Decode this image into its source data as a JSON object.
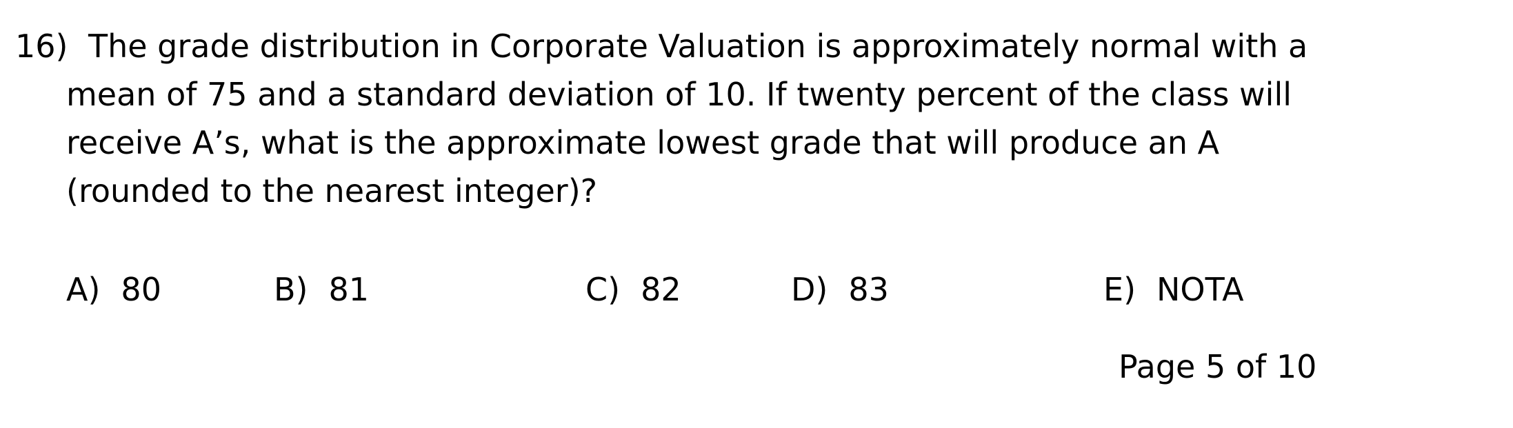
{
  "question": {
    "number": "16)",
    "lines": [
      "The grade distribution in Corporate Valuation is approximately normal with a",
      "mean of 75 and a standard deviation of 10.  If twenty percent of the class will",
      "receive A’s, what is the approximate lowest grade that will produce an A",
      "(rounded to the nearest integer)?"
    ]
  },
  "choices": [
    {
      "letter": "A)",
      "value": "80"
    },
    {
      "letter": "B)",
      "value": "81"
    },
    {
      "letter": "C)",
      "value": "82"
    },
    {
      "letter": "D)",
      "value": "83"
    },
    {
      "letter": "E)",
      "value": "NOTA"
    }
  ],
  "footer": {
    "page_label": "Page 5 of 10"
  }
}
